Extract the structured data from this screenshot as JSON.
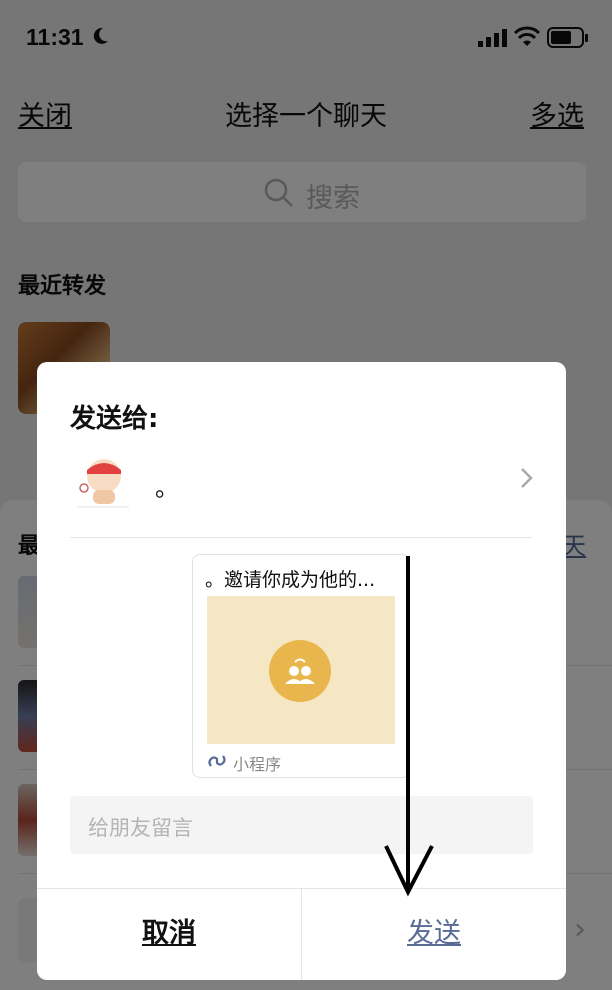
{
  "status_bar": {
    "time": "11:31"
  },
  "nav": {
    "close": "关闭",
    "title": "选择一个聊天",
    "multi_select": "多选"
  },
  "search": {
    "placeholder": "搜索"
  },
  "recent_forward": {
    "title": "最近转发"
  },
  "background_sheet": {
    "section_title_partial": "最",
    "link_partial": "天"
  },
  "dialog": {
    "send_to_label": "发送给:",
    "recipient_name": "。",
    "card": {
      "title": "。邀请你成为他的...",
      "source_label": "小程序"
    },
    "message_placeholder": "给朋友留言",
    "cancel_label": "取消",
    "send_label": "发送"
  },
  "colors": {
    "link": "#576b95",
    "accent_circle": "#e8b64d",
    "card_bg": "#f5e6c4"
  }
}
